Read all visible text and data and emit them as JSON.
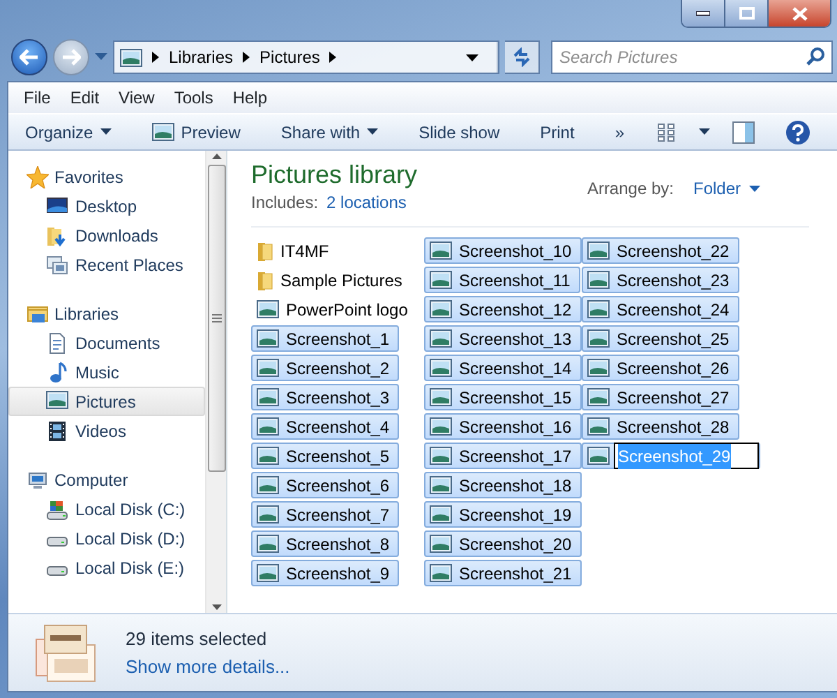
{
  "address": {
    "segments": [
      "Libraries",
      "Pictures"
    ]
  },
  "search": {
    "placeholder": "Search Pictures"
  },
  "menu": [
    "File",
    "Edit",
    "View",
    "Tools",
    "Help"
  ],
  "toolbar": [
    {
      "label": "Organize",
      "kind": "dropdown"
    },
    {
      "label": "Preview",
      "kind": "with-icon"
    },
    {
      "label": "Share with",
      "kind": "dropdown"
    },
    {
      "label": "Slide show",
      "kind": "plain"
    },
    {
      "label": "Print",
      "kind": "plain"
    },
    {
      "label": "»",
      "kind": "plain"
    }
  ],
  "sidebar": [
    {
      "label": "Favorites",
      "items": [
        {
          "label": "Desktop",
          "selected": false
        },
        {
          "label": "Downloads",
          "selected": false
        },
        {
          "label": "Recent Places",
          "selected": false
        }
      ]
    },
    {
      "label": "Libraries",
      "items": [
        {
          "label": "Documents",
          "selected": false
        },
        {
          "label": "Music",
          "selected": false
        },
        {
          "label": "Pictures",
          "selected": true
        },
        {
          "label": "Videos",
          "selected": false
        }
      ]
    },
    {
      "label": "Computer",
      "items": [
        {
          "label": "Local Disk (C:)",
          "selected": false
        },
        {
          "label": "Local Disk (D:)",
          "selected": false
        },
        {
          "label": "Local Disk (E:)",
          "selected": false
        }
      ]
    }
  ],
  "header": {
    "title": "Pictures library",
    "includes_label": "Includes:",
    "includes_link": "2 locations",
    "arrange_label": "Arrange by:",
    "arrange_value": "Folder"
  },
  "files": [
    {
      "name": "IT4MF",
      "kind": "folder",
      "selected": false,
      "renaming": false
    },
    {
      "name": "Sample Pictures",
      "kind": "folder",
      "selected": false,
      "renaming": false
    },
    {
      "name": "PowerPoint logo",
      "kind": "picture",
      "selected": false,
      "renaming": false
    },
    {
      "name": "Screenshot_1",
      "kind": "picture",
      "selected": true,
      "renaming": false
    },
    {
      "name": "Screenshot_2",
      "kind": "picture",
      "selected": true,
      "renaming": false
    },
    {
      "name": "Screenshot_3",
      "kind": "picture",
      "selected": true,
      "renaming": false
    },
    {
      "name": "Screenshot_4",
      "kind": "picture",
      "selected": true,
      "renaming": false
    },
    {
      "name": "Screenshot_5",
      "kind": "picture",
      "selected": true,
      "renaming": false
    },
    {
      "name": "Screenshot_6",
      "kind": "picture",
      "selected": true,
      "renaming": false
    },
    {
      "name": "Screenshot_7",
      "kind": "picture",
      "selected": true,
      "renaming": false
    },
    {
      "name": "Screenshot_8",
      "kind": "picture",
      "selected": true,
      "renaming": false
    },
    {
      "name": "Screenshot_9",
      "kind": "picture",
      "selected": true,
      "renaming": false
    },
    {
      "name": "Screenshot_10",
      "kind": "picture",
      "selected": true,
      "renaming": false
    },
    {
      "name": "Screenshot_11",
      "kind": "picture",
      "selected": true,
      "renaming": false
    },
    {
      "name": "Screenshot_12",
      "kind": "picture",
      "selected": true,
      "renaming": false
    },
    {
      "name": "Screenshot_13",
      "kind": "picture",
      "selected": true,
      "renaming": false
    },
    {
      "name": "Screenshot_14",
      "kind": "picture",
      "selected": true,
      "renaming": false
    },
    {
      "name": "Screenshot_15",
      "kind": "picture",
      "selected": true,
      "renaming": false
    },
    {
      "name": "Screenshot_16",
      "kind": "picture",
      "selected": true,
      "renaming": false
    },
    {
      "name": "Screenshot_17",
      "kind": "picture",
      "selected": true,
      "renaming": false
    },
    {
      "name": "Screenshot_18",
      "kind": "picture",
      "selected": true,
      "renaming": false
    },
    {
      "name": "Screenshot_19",
      "kind": "picture",
      "selected": true,
      "renaming": false
    },
    {
      "name": "Screenshot_20",
      "kind": "picture",
      "selected": true,
      "renaming": false
    },
    {
      "name": "Screenshot_21",
      "kind": "picture",
      "selected": true,
      "renaming": false
    },
    {
      "name": "Screenshot_22",
      "kind": "picture",
      "selected": true,
      "renaming": false
    },
    {
      "name": "Screenshot_23",
      "kind": "picture",
      "selected": true,
      "renaming": false
    },
    {
      "name": "Screenshot_24",
      "kind": "picture",
      "selected": true,
      "renaming": false
    },
    {
      "name": "Screenshot_25",
      "kind": "picture",
      "selected": true,
      "renaming": false
    },
    {
      "name": "Screenshot_26",
      "kind": "picture",
      "selected": true,
      "renaming": false
    },
    {
      "name": "Screenshot_27",
      "kind": "picture",
      "selected": true,
      "renaming": false
    },
    {
      "name": "Screenshot_28",
      "kind": "picture",
      "selected": true,
      "renaming": false
    },
    {
      "name": "Screenshot_29",
      "kind": "picture",
      "selected": true,
      "renaming": true
    }
  ],
  "details": {
    "summary": "29 items selected",
    "link": "Show more details..."
  }
}
